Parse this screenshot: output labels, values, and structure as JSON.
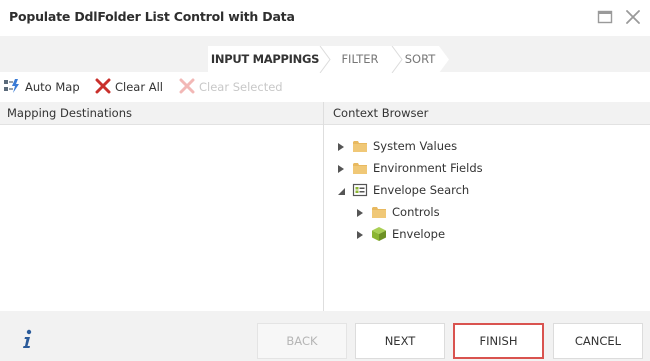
{
  "dialog": {
    "title": "Populate DdlFolder List Control with Data"
  },
  "wizard": {
    "steps": [
      {
        "label": "INPUT MAPPINGS",
        "active": true
      },
      {
        "label": "FILTER",
        "active": false
      },
      {
        "label": "SORT",
        "active": false
      }
    ]
  },
  "toolbar": {
    "auto_map": "Auto Map",
    "clear_all": "Clear All",
    "clear_selected": "Clear Selected"
  },
  "panes": {
    "mapping_destinations": "Mapping Destinations",
    "context_browser": "Context Browser"
  },
  "tree": [
    {
      "label": "System Values",
      "icon": "folder-icon",
      "expanded": false,
      "depth": 0
    },
    {
      "label": "Environment Fields",
      "icon": "folder-icon",
      "expanded": false,
      "depth": 0
    },
    {
      "label": "Envelope Search",
      "icon": "list-control-icon",
      "expanded": true,
      "depth": 0
    },
    {
      "label": "Controls",
      "icon": "folder-icon",
      "expanded": false,
      "depth": 1
    },
    {
      "label": "Envelope",
      "icon": "smartobject-cube-icon",
      "expanded": false,
      "depth": 1
    }
  ],
  "footer": {
    "back": "BACK",
    "next": "NEXT",
    "finish": "FINISH",
    "cancel": "CANCEL"
  },
  "colors": {
    "highlight_border": "#d9534f",
    "band_background": "#f2f2f2",
    "folder": "#e8b960",
    "cube": "#8bb532",
    "clear_x": "#c9302c"
  }
}
